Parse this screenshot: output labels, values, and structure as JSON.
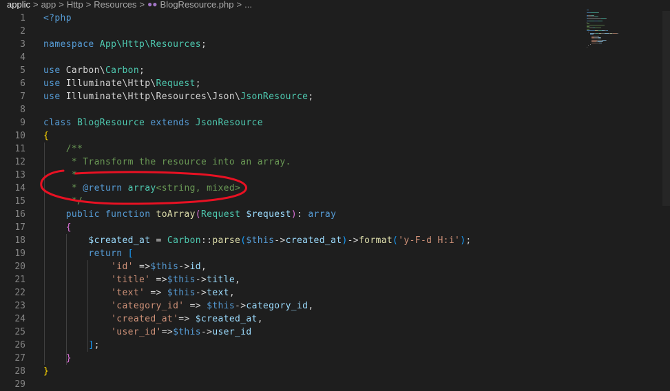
{
  "breadcrumb": {
    "items": [
      "applic",
      "app",
      "Http",
      "Resources",
      "BlogResource.php",
      "..."
    ],
    "separator": ">"
  },
  "editor": {
    "language": "php",
    "lines": [
      {
        "n": "1",
        "tokens": [
          [
            "<?php",
            "kw"
          ]
        ]
      },
      {
        "n": "2",
        "tokens": []
      },
      {
        "n": "3",
        "tokens": [
          [
            "namespace ",
            "kw"
          ],
          [
            "App\\Http\\Resources",
            "cls"
          ],
          [
            ";",
            "plain"
          ]
        ]
      },
      {
        "n": "4",
        "tokens": []
      },
      {
        "n": "5",
        "tokens": [
          [
            "use ",
            "kw"
          ],
          [
            "Carbon\\",
            "ns"
          ],
          [
            "Carbon",
            "cls"
          ],
          [
            ";",
            "plain"
          ]
        ]
      },
      {
        "n": "6",
        "tokens": [
          [
            "use ",
            "kw"
          ],
          [
            "Illuminate\\Http\\",
            "ns"
          ],
          [
            "Request",
            "cls"
          ],
          [
            ";",
            "plain"
          ]
        ]
      },
      {
        "n": "7",
        "tokens": [
          [
            "use ",
            "kw"
          ],
          [
            "Illuminate\\Http\\Resources\\Json\\",
            "ns"
          ],
          [
            "JsonResource",
            "cls"
          ],
          [
            ";",
            "plain"
          ]
        ]
      },
      {
        "n": "8",
        "tokens": []
      },
      {
        "n": "9",
        "tokens": [
          [
            "class ",
            "kw"
          ],
          [
            "BlogResource ",
            "cls"
          ],
          [
            "extends ",
            "kw"
          ],
          [
            "JsonResource",
            "cls"
          ]
        ]
      },
      {
        "n": "10",
        "tokens": [
          [
            "{",
            "br1"
          ]
        ]
      },
      {
        "n": "11",
        "tokens": [
          [
            "    /**",
            "cmt"
          ]
        ]
      },
      {
        "n": "12",
        "tokens": [
          [
            "     * Transform the resource into an array.",
            "cmt"
          ]
        ]
      },
      {
        "n": "13",
        "tokens": [
          [
            "     *",
            "cmt"
          ]
        ]
      },
      {
        "n": "14",
        "tokens": [
          [
            "     * ",
            "cmt"
          ],
          [
            "@return ",
            "doc"
          ],
          [
            "array",
            "cls"
          ],
          [
            "<string, mixed>",
            "cmt"
          ]
        ]
      },
      {
        "n": "15",
        "tokens": [
          [
            "     */",
            "cmt"
          ]
        ]
      },
      {
        "n": "16",
        "tokens": [
          [
            "    public ",
            "kw"
          ],
          [
            "function ",
            "kw"
          ],
          [
            "toArray",
            "fn"
          ],
          [
            "(",
            "br2"
          ],
          [
            "Request ",
            "cls"
          ],
          [
            "$request",
            "var"
          ],
          [
            ")",
            "br2"
          ],
          [
            ": ",
            "plain"
          ],
          [
            "array",
            "kw"
          ]
        ]
      },
      {
        "n": "17",
        "tokens": [
          [
            "    ",
            "plain"
          ],
          [
            "{",
            "br2"
          ]
        ]
      },
      {
        "n": "18",
        "tokens": [
          [
            "        ",
            "plain"
          ],
          [
            "$created_at",
            "var"
          ],
          [
            " = ",
            "op"
          ],
          [
            "Carbon",
            "cls"
          ],
          [
            "::",
            "op"
          ],
          [
            "parse",
            "fn"
          ],
          [
            "(",
            "br3"
          ],
          [
            "$this",
            "this"
          ],
          [
            "->",
            "op"
          ],
          [
            "created_at",
            "var"
          ],
          [
            ")",
            "br3"
          ],
          [
            "->",
            "op"
          ],
          [
            "format",
            "fn"
          ],
          [
            "(",
            "br3"
          ],
          [
            "'y-F-d H:i'",
            "str"
          ],
          [
            ")",
            "br3"
          ],
          [
            ";",
            "plain"
          ]
        ]
      },
      {
        "n": "19",
        "tokens": [
          [
            "        ",
            "plain"
          ],
          [
            "return ",
            "kw"
          ],
          [
            "[",
            "br3"
          ]
        ]
      },
      {
        "n": "20",
        "tokens": [
          [
            "            ",
            "plain"
          ],
          [
            "'id'",
            "str"
          ],
          [
            " =>",
            "op"
          ],
          [
            "$this",
            "this"
          ],
          [
            "->",
            "op"
          ],
          [
            "id",
            "var"
          ],
          [
            ",",
            "plain"
          ]
        ]
      },
      {
        "n": "21",
        "tokens": [
          [
            "            ",
            "plain"
          ],
          [
            "'title'",
            "str"
          ],
          [
            " =>",
            "op"
          ],
          [
            "$this",
            "this"
          ],
          [
            "->",
            "op"
          ],
          [
            "title",
            "var"
          ],
          [
            ",",
            "plain"
          ]
        ]
      },
      {
        "n": "22",
        "tokens": [
          [
            "            ",
            "plain"
          ],
          [
            "'text'",
            "str"
          ],
          [
            " => ",
            "op"
          ],
          [
            "$this",
            "this"
          ],
          [
            "->",
            "op"
          ],
          [
            "text",
            "var"
          ],
          [
            ",",
            "plain"
          ]
        ]
      },
      {
        "n": "23",
        "tokens": [
          [
            "            ",
            "plain"
          ],
          [
            "'category_id'",
            "str"
          ],
          [
            " => ",
            "op"
          ],
          [
            "$this",
            "this"
          ],
          [
            "->",
            "op"
          ],
          [
            "category_id",
            "var"
          ],
          [
            ",",
            "plain"
          ]
        ]
      },
      {
        "n": "24",
        "tokens": [
          [
            "            ",
            "plain"
          ],
          [
            "'created_at'",
            "str"
          ],
          [
            "=> ",
            "op"
          ],
          [
            "$created_at",
            "var"
          ],
          [
            ",",
            "plain"
          ]
        ]
      },
      {
        "n": "25",
        "tokens": [
          [
            "            ",
            "plain"
          ],
          [
            "'user_id'",
            "str"
          ],
          [
            "=>",
            "op"
          ],
          [
            "$this",
            "this"
          ],
          [
            "->",
            "op"
          ],
          [
            "user_id",
            "var"
          ]
        ]
      },
      {
        "n": "26",
        "tokens": [
          [
            "        ",
            "plain"
          ],
          [
            "]",
            "br3"
          ],
          [
            ";",
            "plain"
          ]
        ]
      },
      {
        "n": "27",
        "tokens": [
          [
            "    ",
            "plain"
          ],
          [
            "}",
            "br2"
          ]
        ]
      },
      {
        "n": "28",
        "tokens": [
          [
            "}",
            "br1"
          ]
        ]
      },
      {
        "n": "29",
        "tokens": []
      }
    ]
  },
  "colors": {
    "background": "#1e1e1e",
    "line_number": "#858585",
    "annotation_stroke": "#e81123"
  },
  "icons": {
    "file_type": "php-elephant-icon",
    "separator": "chevron-right-icon"
  }
}
